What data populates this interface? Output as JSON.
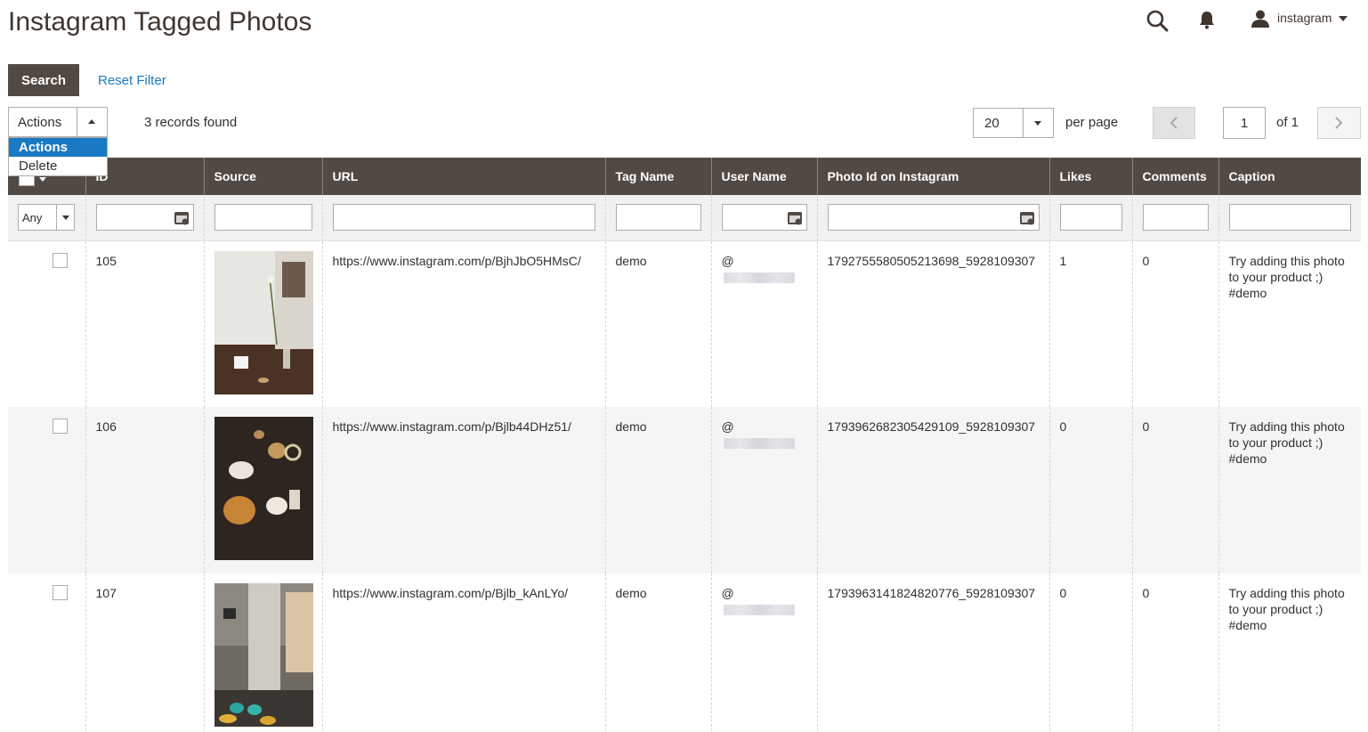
{
  "page": {
    "title": "Instagram Tagged Photos"
  },
  "header": {
    "user_name": "instagram"
  },
  "toolbar": {
    "search_label": "Search",
    "reset_label": "Reset Filter",
    "actions_label": "Actions",
    "actions_options": [
      "Actions",
      "Delete"
    ],
    "records_found": "3 records found",
    "per_page_value": "20",
    "per_page_label": "per page",
    "current_page": "1",
    "page_of": "of 1"
  },
  "grid": {
    "columns": [
      "ID",
      "Source",
      "URL",
      "Tag Name",
      "User Name",
      "Photo Id on Instagram",
      "Likes",
      "Comments",
      "Caption"
    ],
    "filters": {
      "mass_select": "Any"
    },
    "rows": [
      {
        "id": "105",
        "url": "https://www.instagram.com/p/BjhJbO5HMsC/",
        "tag": "demo",
        "user": "@",
        "photo_id": "1792755580505213698_5928109307",
        "likes": "1",
        "comments": "0",
        "caption": "Try adding this photo to your product ;) #demo"
      },
      {
        "id": "106",
        "url": "https://www.instagram.com/p/Bjlb44DHz51/",
        "tag": "demo",
        "user": "@",
        "photo_id": "1793962682305429109_5928109307",
        "likes": "0",
        "comments": "0",
        "caption": "Try adding this photo to your product ;) #demo"
      },
      {
        "id": "107",
        "url": "https://www.instagram.com/p/Bjlb_kAnLYo/",
        "tag": "demo",
        "user": "@",
        "photo_id": "1793963141824820776_5928109307",
        "likes": "0",
        "comments": "0",
        "caption": "Try adding this photo to your product ;) #demo"
      }
    ]
  },
  "colors": {
    "header_bg": "#514943",
    "link": "#1979c3",
    "active_option": "#1979c3"
  },
  "icons": [
    "search-icon",
    "bell-icon",
    "user-icon",
    "calendar-icon",
    "chevron-left-icon",
    "chevron-right-icon"
  ]
}
